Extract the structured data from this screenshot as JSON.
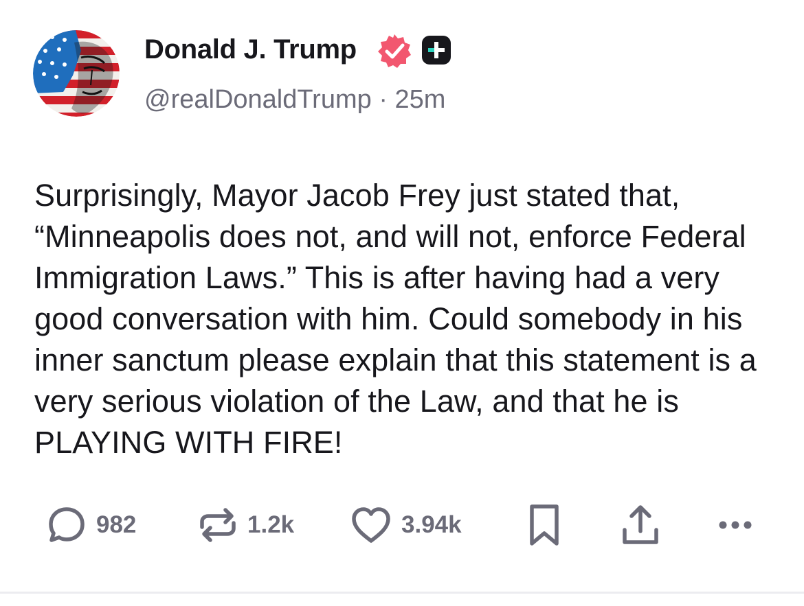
{
  "post": {
    "author": {
      "display_name": "Donald J. Trump",
      "handle": "@realDonaldTrump",
      "separator": "·",
      "timestamp": "25m",
      "avatar_icon": "flag-portrait-avatar",
      "verified_icon": "verified-badge-icon",
      "verified_color": "#f2576f",
      "plus_badge_icon": "plus-badge-icon"
    },
    "body": "Surprisingly, Mayor Jacob Frey just stated that, “Minneapolis does not, and will not, enforce Federal Immigration Laws.” This is after having had a very good conversation with him. Could somebody in his inner sanctum please explain that this statement is a very serious violation of the Law, and that he is PLAYING WITH FIRE!",
    "actions": {
      "replies": {
        "icon": "reply-bubble-icon",
        "count": "982"
      },
      "reposts": {
        "icon": "repost-arrows-icon",
        "count": "1.2k"
      },
      "likes": {
        "icon": "heart-icon",
        "count": "3.94k"
      },
      "bookmark": {
        "icon": "bookmark-icon"
      },
      "share": {
        "icon": "share-upload-icon"
      },
      "more": {
        "icon": "more-dots-icon"
      }
    },
    "colors": {
      "text": "#17171c",
      "secondary_text": "#6b6b78",
      "icon_gray": "#6b6b78",
      "accent_pink": "#f2576f"
    }
  }
}
